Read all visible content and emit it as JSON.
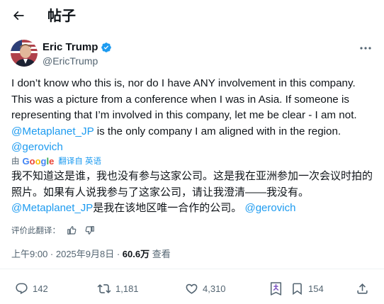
{
  "header": {
    "title": "帖子",
    "back_icon": "arrow-left-icon"
  },
  "author": {
    "name": "Eric Trump",
    "handle": "@EricTrump",
    "verified_color": "#1d9bf0"
  },
  "tweet": {
    "text_plain": "I don’t know who this is, nor do I have ANY involvement in this company. This was a picture from a conference when I was in Asia. If someone is representing that I’m involved in this company, let me be clear - I am not. ",
    "mention_1": "@Metaplanet_JP",
    "text_plain_2": " is the only company I am aligned with in the region.",
    "mention_2": "@gerovich"
  },
  "translation": {
    "by": "由",
    "google_g1": "G",
    "google_o1": "o",
    "google_o2": "o",
    "google_g2": "g",
    "google_l": "l",
    "google_e": "e",
    "link": "翻译自 英语",
    "text_1": "我不知道这是谁，我也没有参与这家公司。这是我在亚洲参加一次会议时拍的照片。如果有人说我参与了这家公司，请让我澄清——我没有。",
    "mention_1": "@Metaplanet_JP",
    "text_2": "是我在该地区唯一合作的公司。",
    "mention_2": "@gerovich",
    "rate_label": "评价此翻译："
  },
  "meta": {
    "time": "上午9:00 · 2025年9月8日 · ",
    "views": "60.6万",
    "views_label": " 查看"
  },
  "actions": {
    "replies": "142",
    "retweets": "1,181",
    "likes": "4,310",
    "bookmarks": "154"
  },
  "colors": {
    "accent": "#1d9bf0",
    "text": "#0f1419",
    "muted": "#536471",
    "bg": "#ffffff"
  }
}
